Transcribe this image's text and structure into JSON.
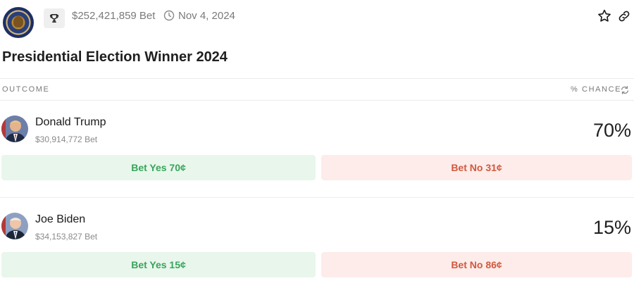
{
  "header": {
    "seal_icon": "presidential-seal",
    "trophy_icon": "trophy-icon",
    "total_volume": "$252,421,859 Bet",
    "date": "Nov 4, 2024"
  },
  "title": "Presidential Election Winner 2024",
  "columns": {
    "outcome": "OUTCOME",
    "chance": "% CHANCE"
  },
  "outcomes": [
    {
      "name": "Donald Trump",
      "volume": "$30,914,772 Bet",
      "chance": "70%",
      "yes_label": "Bet Yes 70¢",
      "no_label": "Bet No 31¢"
    },
    {
      "name": "Joe Biden",
      "volume": "$34,153,827 Bet",
      "chance": "15%",
      "yes_label": "Bet Yes 15¢",
      "no_label": "Bet No 86¢"
    }
  ],
  "colors": {
    "yes_bg": "#e8f6ec",
    "yes_text": "#39a45a",
    "no_bg": "#fdecea",
    "no_text": "#d1593f"
  }
}
